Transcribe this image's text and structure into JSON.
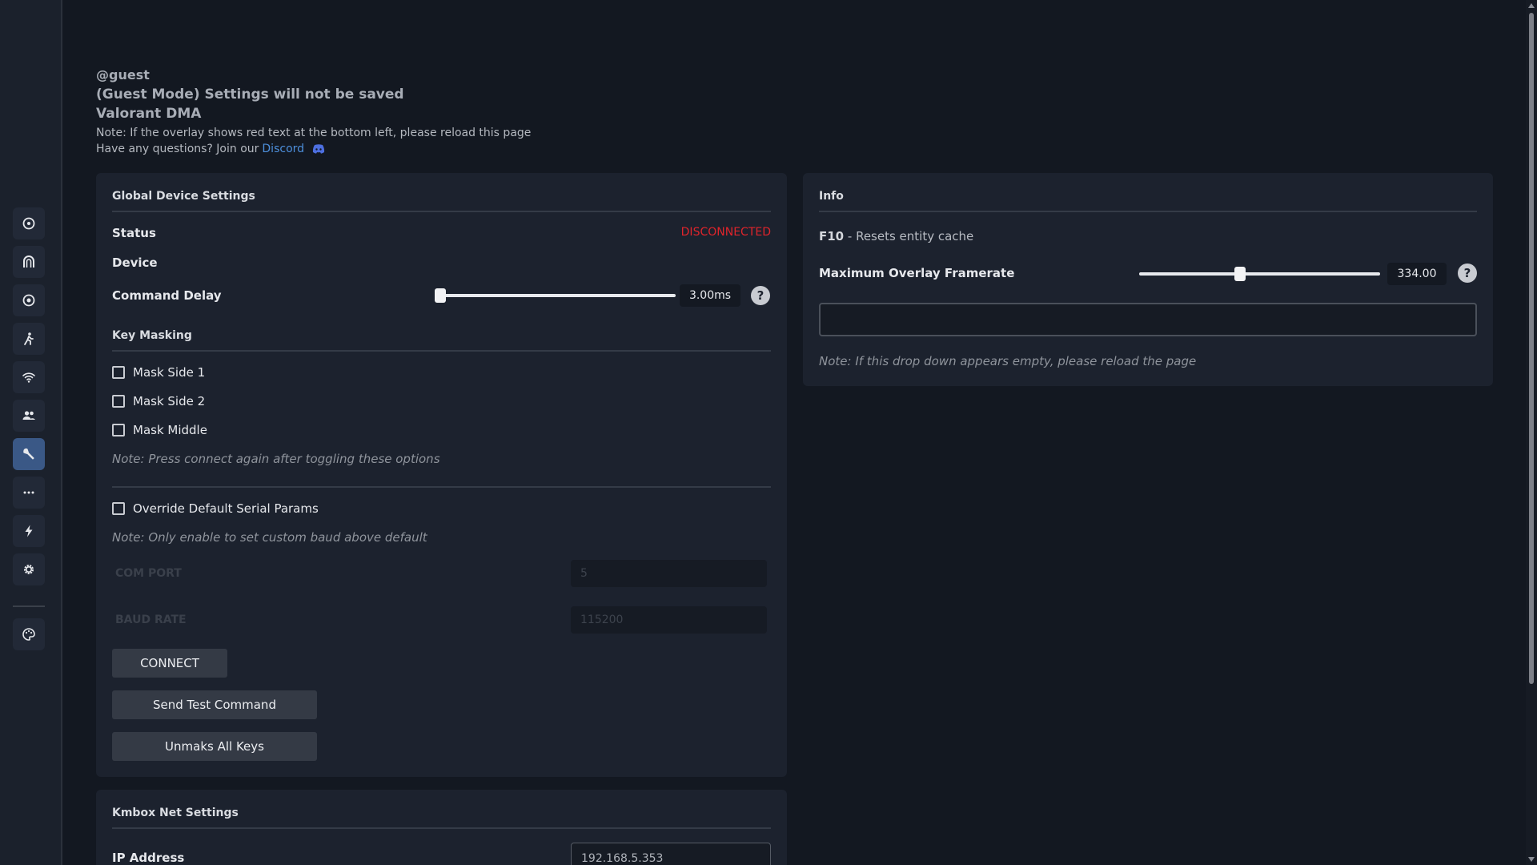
{
  "header": {
    "user": "@guest",
    "guest_mode": "(Guest Mode) Settings will not be saved",
    "game": "Valorant DMA",
    "note": "Note: If the overlay shows red text at the bottom left, please reload this page",
    "questions_prefix": "Have any questions? Join our",
    "discord_link": "Discord"
  },
  "sidebar": {
    "items": [
      {
        "icon": "crosshair-icon"
      },
      {
        "icon": "magnet-icon"
      },
      {
        "icon": "target-icon"
      },
      {
        "icon": "person-running-icon"
      },
      {
        "icon": "wifi-icon"
      },
      {
        "icon": "users-icon"
      },
      {
        "icon": "wrench-icon",
        "active": true
      },
      {
        "icon": "ellipsis-icon"
      },
      {
        "icon": "bolt-icon"
      },
      {
        "icon": "gear-icon"
      },
      {
        "icon": "palette-icon"
      }
    ]
  },
  "global": {
    "title": "Global Device Settings",
    "status_label": "Status",
    "status_value": "DISCONNECTED",
    "device_label": "Device",
    "command_delay_label": "Command Delay",
    "command_delay_value": "3.00ms",
    "command_delay_fraction": 0.02,
    "key_masking_title": "Key Masking",
    "mask_side1": "Mask Side 1",
    "mask_side2": "Mask Side 2",
    "mask_middle": "Mask Middle",
    "masking_note": "Note: Press connect again after toggling these options",
    "override_label": "Override Default Serial Params",
    "override_note": "Note: Only enable to set custom baud above default",
    "com_port_label": "COM PORT",
    "com_port_value": "5",
    "baud_rate_label": "BAUD RATE",
    "baud_rate_value": "115200",
    "connect_button": "CONNECT",
    "test_button": "Send Test Command",
    "unmask_button": "Unmaks All Keys"
  },
  "info": {
    "title": "Info",
    "f10_key": "F10",
    "f10_desc": " - Resets entity cache",
    "framerate_label": "Maximum Overlay Framerate",
    "framerate_value": "334.00",
    "framerate_fraction": 0.42,
    "dropdown_note": "Note: If this drop down appears empty, please reload the page"
  },
  "kmbox": {
    "title": "Kmbox Net Settings",
    "ip_label": "IP Address",
    "ip_value": "192.168.5.353"
  },
  "colors": {
    "accent": "#3a5886",
    "status_error": "#e0242b",
    "link": "#4d8fdc"
  }
}
